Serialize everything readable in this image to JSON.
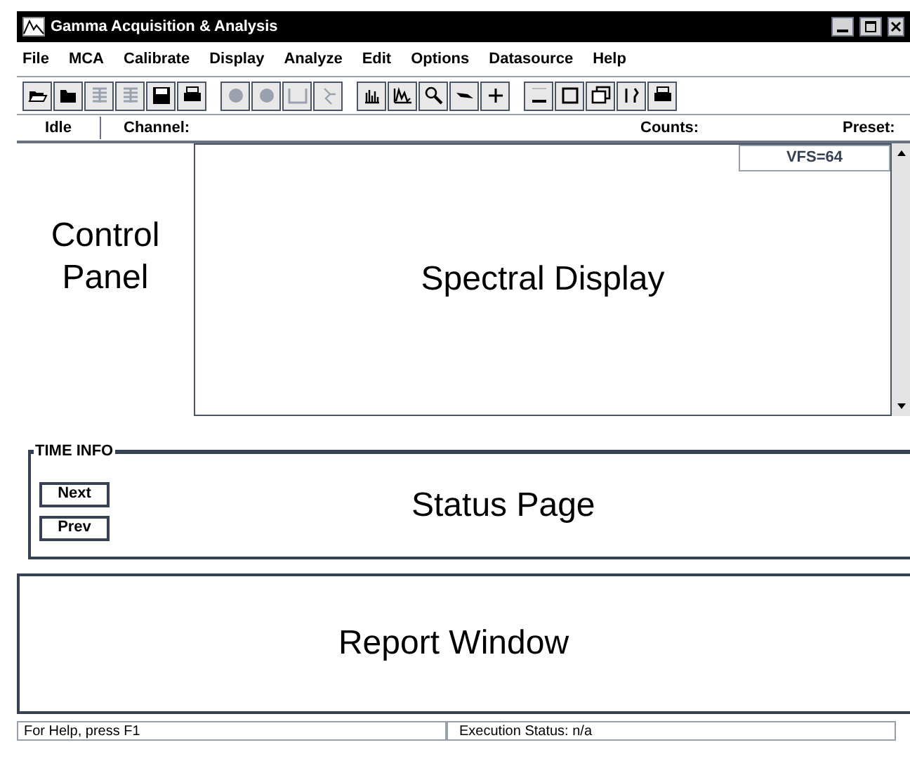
{
  "window": {
    "title": "Gamma Acquisition & Analysis"
  },
  "menu": [
    "File",
    "MCA",
    "Calibrate",
    "Display",
    "Analyze",
    "Edit",
    "Options",
    "Datasource",
    "Help"
  ],
  "toolbar": [
    [
      {
        "kind": "open",
        "disabled": false
      },
      {
        "kind": "folder",
        "disabled": false
      },
      {
        "kind": "stack",
        "disabled": true
      },
      {
        "kind": "stack",
        "disabled": true
      },
      {
        "kind": "disk",
        "disabled": false
      },
      {
        "kind": "printer",
        "disabled": false
      }
    ],
    [
      {
        "kind": "circle",
        "disabled": true
      },
      {
        "kind": "circle",
        "disabled": true
      },
      {
        "kind": "blank",
        "disabled": true
      },
      {
        "kind": "figure",
        "disabled": true
      }
    ],
    [
      {
        "kind": "bars",
        "disabled": false
      },
      {
        "kind": "peaks",
        "disabled": false
      },
      {
        "kind": "zoom",
        "disabled": false
      },
      {
        "kind": "arrow",
        "disabled": false
      },
      {
        "kind": "plus",
        "disabled": false
      }
    ],
    [
      {
        "kind": "minus",
        "disabled": false
      },
      {
        "kind": "window",
        "disabled": false
      },
      {
        "kind": "windows",
        "disabled": false
      },
      {
        "kind": "tool",
        "disabled": false
      },
      {
        "kind": "printer",
        "disabled": false
      }
    ]
  ],
  "info_bar": {
    "state": "Idle",
    "channel": "Channel:",
    "counts": "Counts:",
    "preset": "Preset:"
  },
  "control_panel": {
    "label": "Control Panel"
  },
  "spectral_display": {
    "label": "Spectral Display",
    "vfs": "VFS=64"
  },
  "time_info": {
    "title": "TIME INFO",
    "buttons": [
      "Next",
      "Prev"
    ],
    "label": "Status Page"
  },
  "report_window": {
    "label": "Report Window"
  },
  "status_bar": [
    "For Help, press F1",
    "Execution Status:  n/a"
  ]
}
